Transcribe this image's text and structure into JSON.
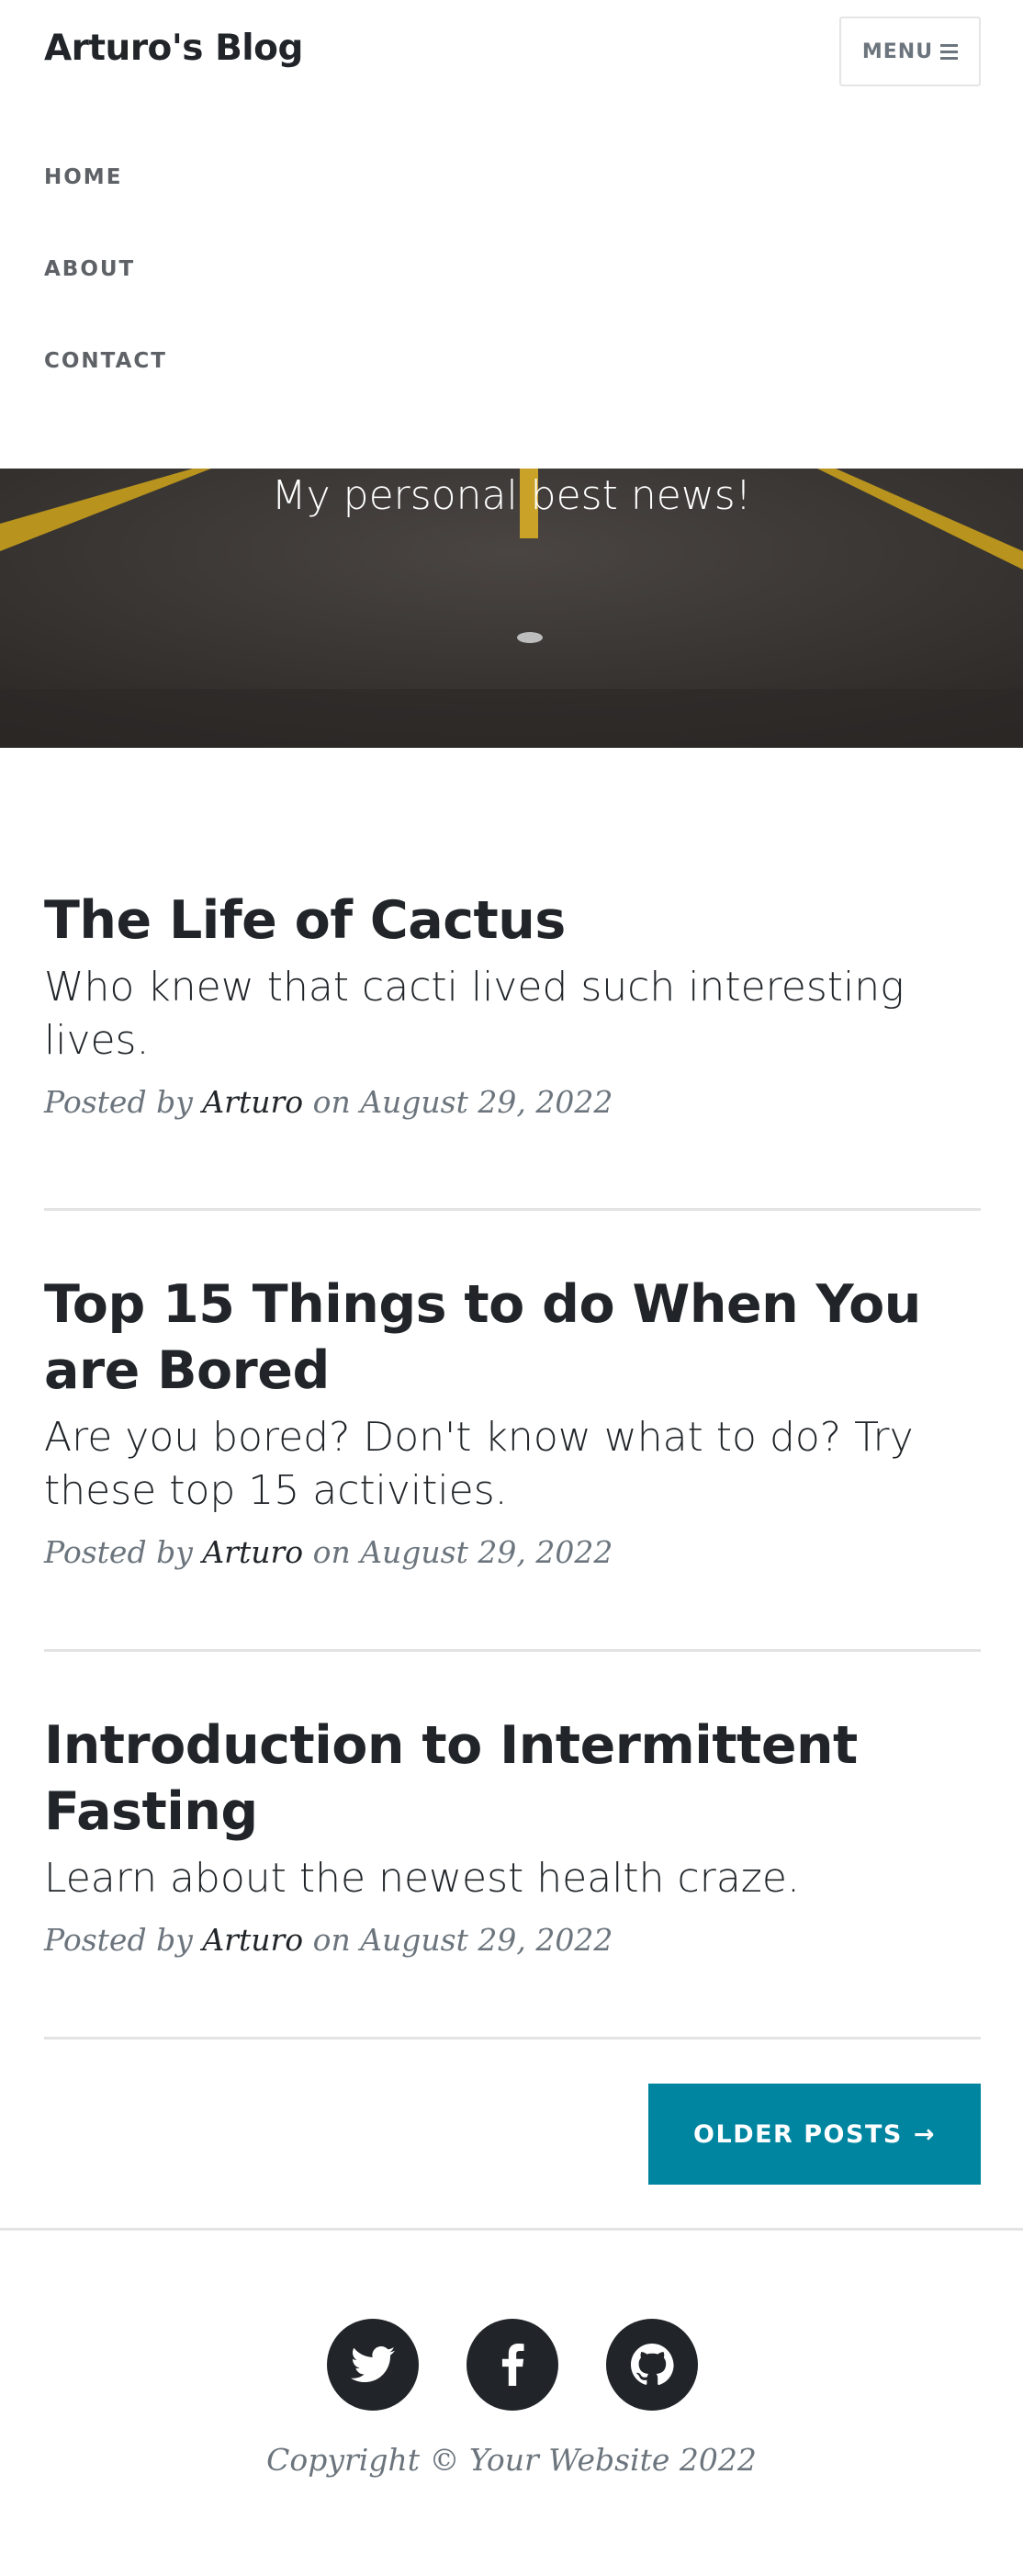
{
  "nav": {
    "brand": "Arturo's Blog",
    "menu_label": "MENU",
    "links": [
      "HOME",
      "ABOUT",
      "CONTACT"
    ]
  },
  "hero": {
    "subheading": "My personal best news!"
  },
  "posts": [
    {
      "title": "The Life of Cactus",
      "subtitle": "Who knew that cacti lived such interesting lives.",
      "meta_prefix": "Posted by",
      "author": "Arturo",
      "meta_date": "on August 29, 2022"
    },
    {
      "title": "Top 15 Things to do When You are Bored",
      "subtitle": "Are you bored? Don't know what to do? Try these top 15 activities.",
      "meta_prefix": "Posted by",
      "author": "Arturo",
      "meta_date": "on August 29, 2022"
    },
    {
      "title": "Introduction to Intermittent Fasting",
      "subtitle": "Learn about the newest health craze.",
      "meta_prefix": "Posted by",
      "author": "Arturo",
      "meta_date": "on August 29, 2022"
    }
  ],
  "pager": {
    "older_label": "OLDER POSTS",
    "arrow": "→"
  },
  "footer": {
    "socials": [
      "twitter-icon",
      "facebook-icon",
      "github-icon"
    ],
    "copyright": "Copyright © Your Website 2022"
  },
  "colors": {
    "accent": "#0085a1",
    "text": "#212529",
    "muted": "#6c757d"
  }
}
